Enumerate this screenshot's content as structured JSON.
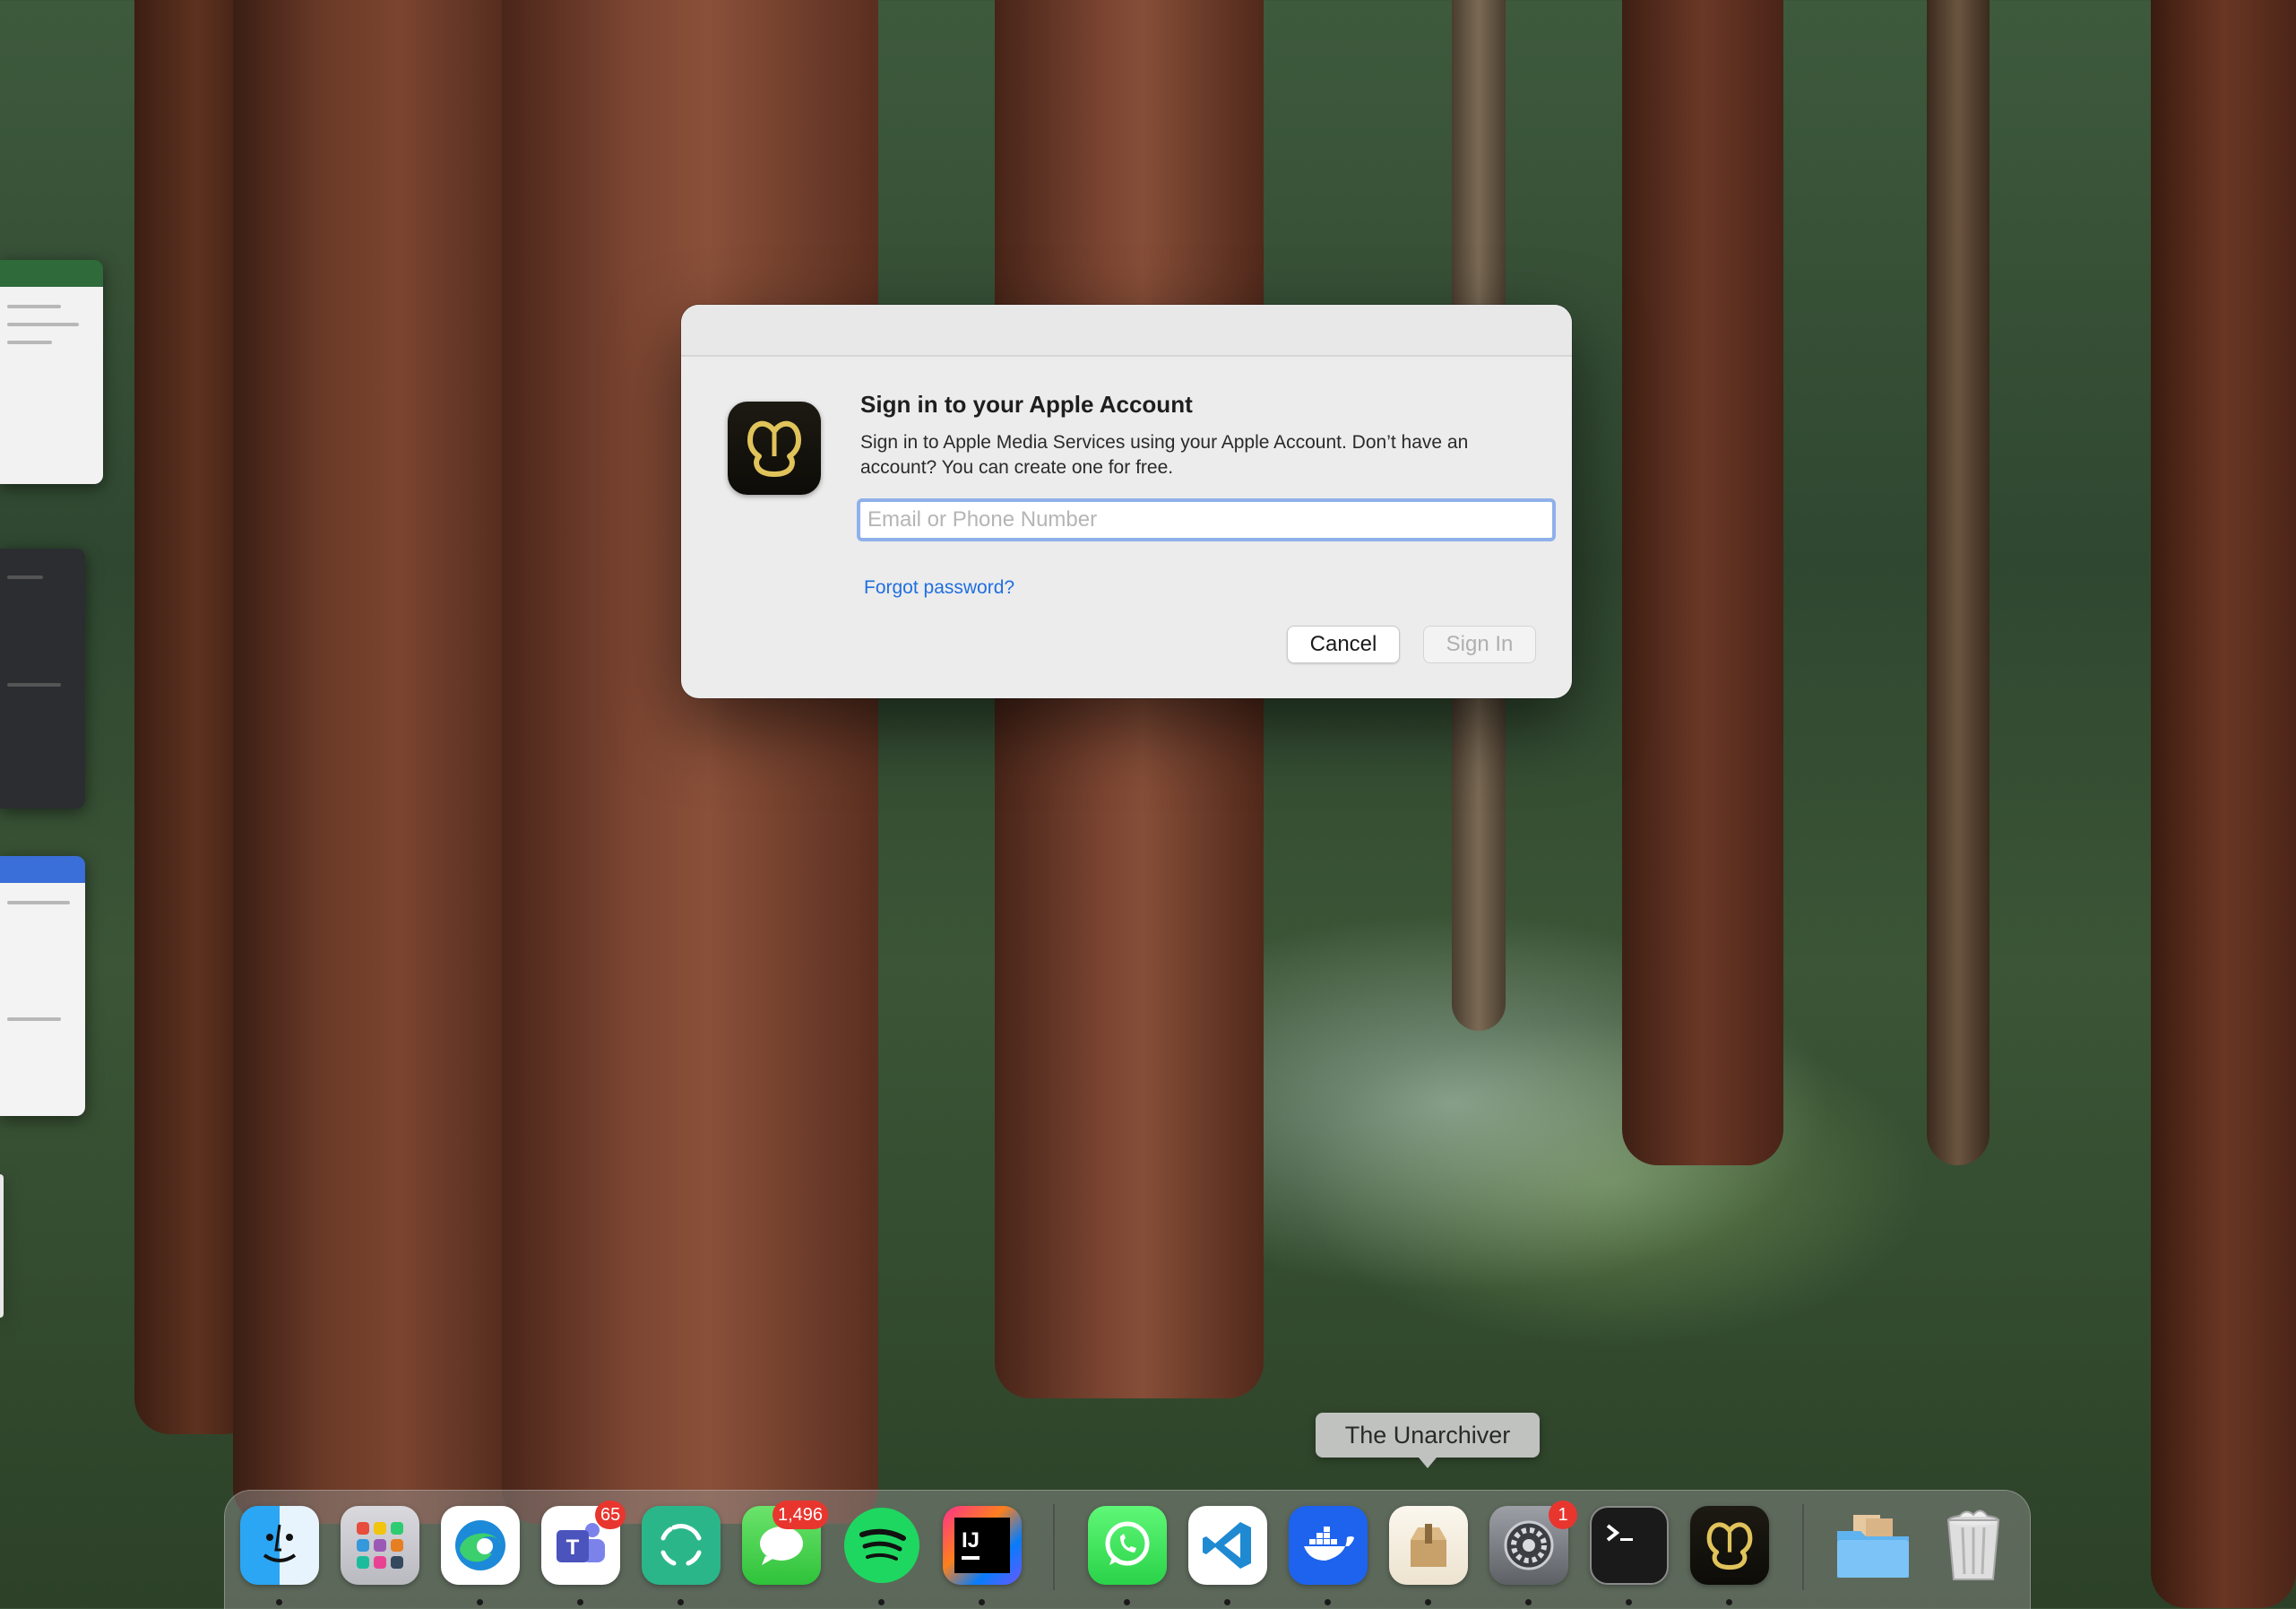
{
  "dialog": {
    "title": "Sign in to your Apple Account",
    "description": "Sign in to Apple Media Services using your Apple Account. Don’t have an account? You can create one for free.",
    "email_placeholder": "Email or Phone Number",
    "email_value": "",
    "forgot_label": "Forgot password?",
    "cancel_label": "Cancel",
    "signin_label": "Sign In",
    "app_icon": "navicat-icon"
  },
  "tooltip": {
    "text": "The Unarchiver"
  },
  "dock": {
    "items": [
      {
        "name": "Finder",
        "icon": "finder-icon",
        "running": true
      },
      {
        "name": "Launchpad",
        "icon": "launchpad-icon",
        "running": false
      },
      {
        "name": "Microsoft Edge",
        "icon": "edge-icon",
        "running": true
      },
      {
        "name": "Microsoft Teams",
        "icon": "teams-icon",
        "running": true,
        "badge": "65"
      },
      {
        "name": "Element",
        "icon": "element-icon",
        "running": true
      },
      {
        "name": "Messages",
        "icon": "messages-icon",
        "running": false,
        "badge": "1,496"
      },
      {
        "name": "Spotify",
        "icon": "spotify-icon",
        "running": true
      },
      {
        "name": "IntelliJ IDEA",
        "icon": "intellij-icon",
        "running": true
      },
      {
        "name": "WhatsApp",
        "icon": "whatsapp-icon",
        "running": true
      },
      {
        "name": "Visual Studio Code",
        "icon": "vscode-icon",
        "running": true
      },
      {
        "name": "Docker",
        "icon": "docker-icon",
        "running": true
      },
      {
        "name": "The Unarchiver",
        "icon": "unarchiver-icon",
        "running": true
      },
      {
        "name": "System Settings",
        "icon": "settings-icon",
        "running": true,
        "badge": "1"
      },
      {
        "name": "Terminal",
        "icon": "terminal-icon",
        "running": true
      },
      {
        "name": "Navicat",
        "icon": "navicat-icon",
        "running": true
      },
      {
        "name": "Downloads",
        "icon": "folder-icon",
        "running": false
      },
      {
        "name": "Trash",
        "icon": "trash-icon",
        "running": false
      }
    ]
  },
  "colors": {
    "accent": "#1f6fe0",
    "focus_ring": "#8fb0ea",
    "badge": "#e8362f",
    "navicat_gold": "#e0c35a"
  }
}
